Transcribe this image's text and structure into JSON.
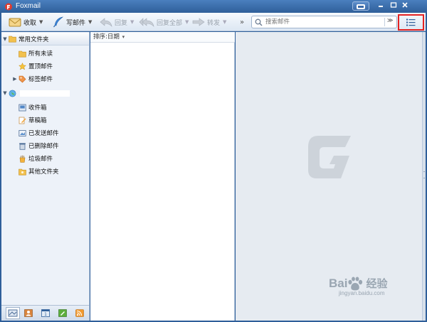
{
  "window": {
    "title": "Foxmail"
  },
  "toolbar": {
    "receive_label": "收取",
    "compose_label": "写邮件",
    "reply_label": "回复",
    "reply_all_label": "回复全部",
    "forward_label": "转发",
    "more_label": "»"
  },
  "search": {
    "placeholder": "搜索邮件"
  },
  "sidebar": {
    "common_header": "常用文件夹",
    "common_items": [
      {
        "label": "所有未读",
        "icon": "folder-icon"
      },
      {
        "label": "置顶邮件",
        "icon": "star-icon"
      },
      {
        "label": "标签邮件",
        "icon": "tag-icon"
      }
    ],
    "account_items": [
      {
        "label": "收件箱",
        "icon": "inbox-icon"
      },
      {
        "label": "草稿箱",
        "icon": "drafts-icon"
      },
      {
        "label": "已发送邮件",
        "icon": "sent-icon"
      },
      {
        "label": "已删除邮件",
        "icon": "trash-icon"
      },
      {
        "label": "垃圾邮件",
        "icon": "junk-icon"
      },
      {
        "label": "其他文件夹",
        "icon": "folder-icon"
      }
    ]
  },
  "maillist": {
    "sort_label": "排序:日期"
  },
  "watermark": {
    "brand": "Bai",
    "brand_end": "经验",
    "url": "jingyan.baidu.com"
  },
  "colors": {
    "titlebar": "#2f5f9a",
    "highlight": "#e32323",
    "preview_bg": "#e6ebf1"
  }
}
